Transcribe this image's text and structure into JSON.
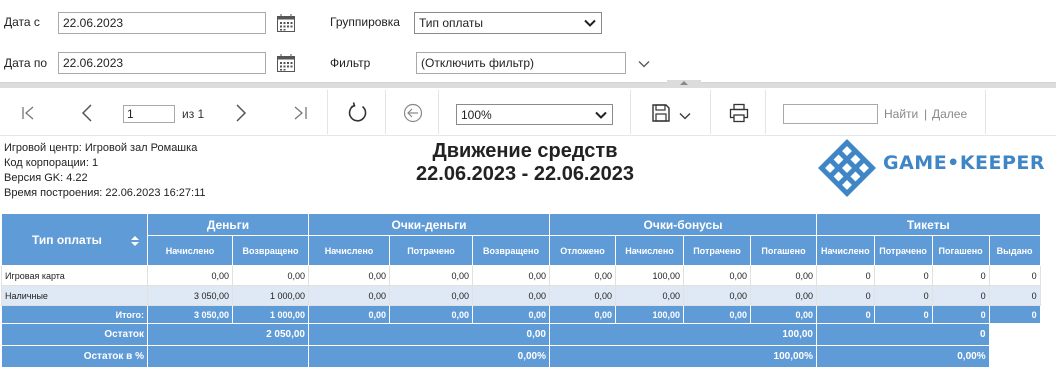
{
  "params": {
    "date_from_label": "Дата с",
    "date_from_value": "22.06.2023",
    "date_to_label": "Дата по",
    "date_to_value": "22.06.2023",
    "grouping_label": "Группировка",
    "grouping_value": "Тип оплаты",
    "filter_label": "Фильтр",
    "filter_value": "(Отключить фильтр)"
  },
  "toolbar": {
    "page_value": "1",
    "page_of": "из 1",
    "zoom_value": "100%",
    "find_label": "Найти",
    "find_sep": "|",
    "next_label": "Далее"
  },
  "report": {
    "info": [
      "Игровой центр: Игровой зал Ромашка",
      "Код корпорации: 1",
      "Версия GK: 4.22",
      "Время построения: 22.06.2023 16:27:11"
    ],
    "title": "Движение средств",
    "dates": "22.06.2023 - 22.06.2023",
    "logo_text": "GAME•KEEPER"
  },
  "table": {
    "col_type": "Тип оплаты",
    "groups": [
      "Деньги",
      "Очки-деньги",
      "Очки-бонусы",
      "Тикеты"
    ],
    "subheaders": [
      "Начислено",
      "Возвращено",
      "Начислено",
      "Потрачено",
      "Возвращено",
      "Отложено",
      "Начислено",
      "Потрачено",
      "Погашено",
      "Начислено",
      "Потрачено",
      "Погашено",
      "Выдано"
    ],
    "rows": [
      {
        "name": "Игровая карта",
        "values": [
          "0,00",
          "0,00",
          "0,00",
          "0,00",
          "0,00",
          "0,00",
          "100,00",
          "0,00",
          "0,00",
          "0",
          "0",
          "0",
          "0"
        ]
      },
      {
        "name": "Наличные",
        "values": [
          "3 050,00",
          "1 000,00",
          "0,00",
          "0,00",
          "0,00",
          "0,00",
          "0,00",
          "0,00",
          "0,00",
          "0",
          "0",
          "0",
          "0"
        ]
      }
    ],
    "total": {
      "name": "Итого:",
      "values": [
        "3 050,00",
        "1 000,00",
        "0,00",
        "0,00",
        "0,00",
        "0,00",
        "100,00",
        "0,00",
        "0,00",
        "0",
        "0",
        "0",
        "0"
      ]
    },
    "balance": {
      "name": "Остаток",
      "money": "2 050,00",
      "points_money": "0,00",
      "points_bonus": "100,00",
      "tickets": "0"
    },
    "balance_pct": {
      "name": "Остаток в %",
      "money": "",
      "points_money": "0,00%",
      "points_bonus": "100,00%",
      "tickets": "0,00%"
    }
  },
  "colors": {
    "header_blue": "#5f9bd6",
    "row_alt": "#dfe9f5",
    "logo_blue": "#3f86c6"
  },
  "icons": [
    "calendar-icon",
    "chevron-down-icon",
    "first-page-icon",
    "prev-page-icon",
    "next-page-icon",
    "last-page-icon",
    "refresh-icon",
    "back-icon",
    "save-icon",
    "print-icon",
    "sort-icon",
    "collapse-arrow-icon"
  ]
}
